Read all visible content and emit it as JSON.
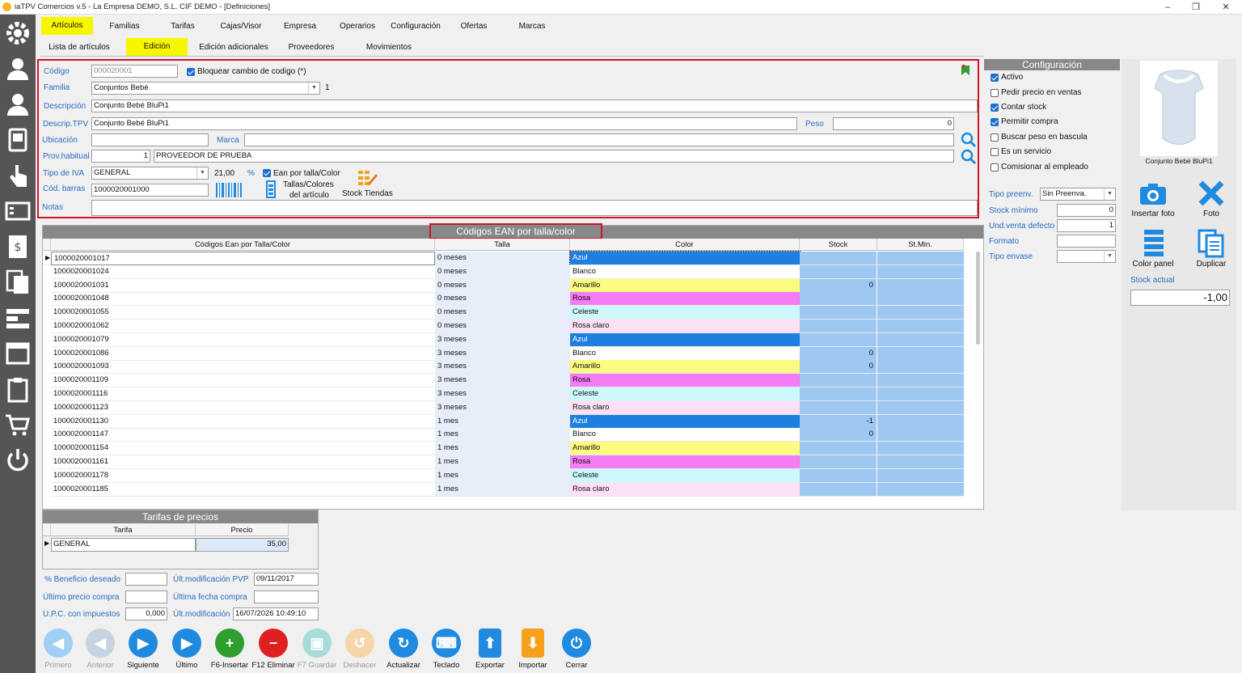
{
  "window": {
    "title": "iaTPV Comercios v.5 - La Empresa DEMO, S.L. CIF DEMO - [Definiciones]",
    "min": "–",
    "max": "❐",
    "close": "✕"
  },
  "top_tabs": [
    "Artículos",
    "Familias",
    "Tarifas",
    "Cajas/Visor",
    "Empresa",
    "Operarios",
    "Configuración",
    "Ofertas",
    "Marcas"
  ],
  "sub_tabs": [
    "Lista de artículos",
    "Edición",
    "Edición adicionales",
    "Proveedores",
    "Movimientos"
  ],
  "form": {
    "codigo_label": "Código",
    "codigo_value": "000020001",
    "bloquear_label": "Bloquear cambio de codigo (*)",
    "familia_label": "Familia",
    "familia_value": "Conjuntos Bebé",
    "familia_num": "1",
    "descripcion_label": "Descripción",
    "descripcion_value": "Conjunto Bebé BluPi1",
    "descrip_tpv_label": "Descrip.TPV",
    "descrip_tpv_value": "Conjunto Bebé BluPi1",
    "peso_label": "Peso",
    "peso_value": "0",
    "ubicacion_label": "Ubicación",
    "ubicacion_value": "",
    "marca_label": "Marca",
    "marca_value": "",
    "prov_label": "Prov.habitual",
    "prov_num": "1",
    "prov_value": "PROVEEDOR DE PRUEBA",
    "iva_label": "Tipo de IVA",
    "iva_value": "GENERAL",
    "iva_pct": "21,00",
    "pct_sign": "%",
    "ean_label": "Ean por talla/Color",
    "barras_label": "Cód. barras",
    "barras_value": "1000020001000",
    "tallas_label1": "Tallas/Colores",
    "tallas_label2": "del artículo",
    "stock_tiendas": "Stock Tiendas",
    "notas_label": "Notas",
    "notas_value": ""
  },
  "config": {
    "header": "Configuración",
    "options": [
      {
        "label": "Activo",
        "checked": true
      },
      {
        "label": "Pedir precio en ventas",
        "checked": false
      },
      {
        "label": "Contar stock",
        "checked": true
      },
      {
        "label": "Permitir compra",
        "checked": true
      },
      {
        "label": "Buscar peso en bascula",
        "checked": false
      },
      {
        "label": "Es un servicio",
        "checked": false
      },
      {
        "label": "Comisionar al empleado",
        "checked": false
      }
    ],
    "tipo_preenv_label": "Tipo preenv.",
    "tipo_preenv_value": "Sin Preenva.",
    "stock_min_label": "Stock mínimo",
    "stock_min_value": "0",
    "und_venta_label": "Und.venta defecto",
    "und_venta_value": "1",
    "formato_label": "Formato",
    "formato_value": "",
    "tipo_envase_label": "Tipo envase",
    "tipo_envase_value": ""
  },
  "photo": {
    "caption": "Conjunto Bebé BluPi1"
  },
  "side_actions": {
    "insertar": "Insertar foto",
    "foto": "Foto",
    "color_panel": "Color panel",
    "duplicar": "Duplicar",
    "stock_actual_label": "Stock actual",
    "stock_actual_value": "-1,00"
  },
  "ean_grid": {
    "title": "Códigos EAN por talla/color",
    "headers": [
      "Códigos Ean por Talla/Color",
      "Talla",
      "Color",
      "Stock",
      "St.Min."
    ],
    "rows": [
      {
        "code": "1000020001017",
        "talla": "0 meses",
        "color": "Azul",
        "bg": "#1e7fe0",
        "stock": ""
      },
      {
        "code": "1000020001024",
        "talla": "0 meses",
        "color": "Blanco",
        "bg": "#ffffff",
        "stock": ""
      },
      {
        "code": "1000020001031",
        "talla": "0 meses",
        "color": "Amarillo",
        "bg": "#fbfb80",
        "stock": "0"
      },
      {
        "code": "1000020001048",
        "talla": "0 meses",
        "color": "Rosa",
        "bg": "#f47cf4",
        "stock": ""
      },
      {
        "code": "1000020001055",
        "talla": "0 meses",
        "color": "Celeste",
        "bg": "#cdf9fd",
        "stock": ""
      },
      {
        "code": "1000020001062",
        "talla": "0 meses",
        "color": "Rosa claro",
        "bg": "#fbe0f6",
        "stock": ""
      },
      {
        "code": "1000020001079",
        "talla": "3 meses",
        "color": "Azul",
        "bg": "#1e7fe0",
        "stock": ""
      },
      {
        "code": "1000020001086",
        "talla": "3 meses",
        "color": "Blanco",
        "bg": "#ffffff",
        "stock": "0"
      },
      {
        "code": "1000020001093",
        "talla": "3 meses",
        "color": "Amarillo",
        "bg": "#fbfb80",
        "stock": "0"
      },
      {
        "code": "1000020001109",
        "talla": "3 meses",
        "color": "Rosa",
        "bg": "#f47cf4",
        "stock": ""
      },
      {
        "code": "1000020001116",
        "talla": "3 meses",
        "color": "Celeste",
        "bg": "#cdf9fd",
        "stock": ""
      },
      {
        "code": "1000020001123",
        "talla": "3 meses",
        "color": "Rosa claro",
        "bg": "#fbe0f6",
        "stock": ""
      },
      {
        "code": "1000020001130",
        "talla": "1 mes",
        "color": "Azul",
        "bg": "#1e7fe0",
        "stock": "-1"
      },
      {
        "code": "1000020001147",
        "talla": "1 mes",
        "color": "Blanco",
        "bg": "#ffffff",
        "stock": "0"
      },
      {
        "code": "1000020001154",
        "talla": "1 mes",
        "color": "Amarillo",
        "bg": "#fbfb80",
        "stock": ""
      },
      {
        "code": "1000020001161",
        "talla": "1 mes",
        "color": "Rosa",
        "bg": "#f47cf4",
        "stock": ""
      },
      {
        "code": "1000020001178",
        "talla": "1 mes",
        "color": "Celeste",
        "bg": "#cdf9fd",
        "stock": ""
      },
      {
        "code": "1000020001185",
        "talla": "1 mes",
        "color": "Rosa claro",
        "bg": "#fbe0f6",
        "stock": ""
      }
    ]
  },
  "tarifas": {
    "title": "Tarifas de precios",
    "headers": [
      "Tarifa",
      "Precio"
    ],
    "rows": [
      {
        "tarifa": "GENERAL",
        "precio": "35,00"
      }
    ]
  },
  "extra": {
    "beneficio_label": "% Beneficio deseado",
    "beneficio_value": "",
    "ult_precio_label": "Último precio compra",
    "ult_precio_value": "",
    "upc_label": "U.P.C. con impuestos",
    "upc_value": "0,000",
    "ult_mod_pvp_label": "Últ.modificación PVP",
    "ult_mod_pvp_value": "09/11/2017",
    "ult_fecha_compra_label": "Última fecha compra",
    "ult_fecha_compra_value": "",
    "ult_mod_label": "Últ.modificación",
    "ult_mod_value": "16/07/2026 10:49:10"
  },
  "toolbar": [
    {
      "label": "Primero",
      "color": "#9fd0f3",
      "enabled": false
    },
    {
      "label": "Anterior",
      "color": "#c5d4e0",
      "enabled": false
    },
    {
      "label": "Siguiente",
      "color": "#1f8ae0",
      "enabled": true
    },
    {
      "label": "Último",
      "color": "#1f8ae0",
      "enabled": true
    },
    {
      "label": "F6-Insertar",
      "color": "#2e9e2e",
      "enabled": true
    },
    {
      "label": "F12 Eliminar",
      "color": "#e02020",
      "enabled": true
    },
    {
      "label": "F7 Guardar",
      "color": "#a8dcd8",
      "enabled": false
    },
    {
      "label": "Deshacer",
      "color": "#f5d6a8",
      "enabled": false
    },
    {
      "label": "Actualizar",
      "color": "#1f8ae0",
      "enabled": true
    },
    {
      "label": "Teclado",
      "color": "#1f8ae0",
      "enabled": true
    },
    {
      "label": "Exportar",
      "color": "#1f8ae0",
      "enabled": true
    },
    {
      "label": "Importar",
      "color": "#f5a11b",
      "enabled": true
    },
    {
      "label": "Cerrar",
      "color": "#1f8ae0",
      "enabled": true
    }
  ]
}
